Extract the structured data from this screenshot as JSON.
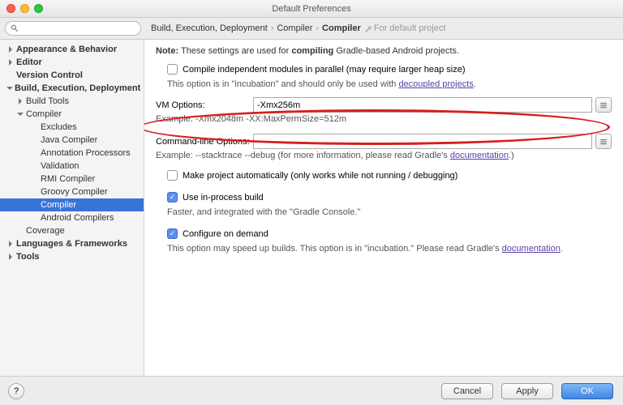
{
  "window": {
    "title": "Default Preferences"
  },
  "search": {
    "placeholder": ""
  },
  "breadcrumb": {
    "parts": [
      "Build, Execution, Deployment",
      "Compiler",
      "Compiler"
    ],
    "hint": "For default project"
  },
  "sidebar": {
    "items": [
      {
        "label": "Appearance & Behavior",
        "depth": 0,
        "arrow": "right",
        "bold": true
      },
      {
        "label": "Editor",
        "depth": 0,
        "arrow": "right",
        "bold": true
      },
      {
        "label": "Version Control",
        "depth": 0,
        "arrow": "none",
        "bold": true
      },
      {
        "label": "Build, Execution, Deployment",
        "depth": 0,
        "arrow": "down",
        "bold": true
      },
      {
        "label": "Build Tools",
        "depth": 1,
        "arrow": "right",
        "bold": false
      },
      {
        "label": "Compiler",
        "depth": 1,
        "arrow": "down",
        "bold": false
      },
      {
        "label": "Excludes",
        "depth": 2,
        "arrow": "none",
        "bold": false
      },
      {
        "label": "Java Compiler",
        "depth": 2,
        "arrow": "none",
        "bold": false
      },
      {
        "label": "Annotation Processors",
        "depth": 2,
        "arrow": "none",
        "bold": false
      },
      {
        "label": "Validation",
        "depth": 2,
        "arrow": "none",
        "bold": false
      },
      {
        "label": "RMI Compiler",
        "depth": 2,
        "arrow": "none",
        "bold": false
      },
      {
        "label": "Groovy Compiler",
        "depth": 2,
        "arrow": "none",
        "bold": false
      },
      {
        "label": "Compiler",
        "depth": 2,
        "arrow": "none",
        "bold": false,
        "selected": true
      },
      {
        "label": "Android Compilers",
        "depth": 2,
        "arrow": "none",
        "bold": false
      },
      {
        "label": "Coverage",
        "depth": 1,
        "arrow": "none",
        "bold": false
      },
      {
        "label": "Languages & Frameworks",
        "depth": 0,
        "arrow": "right",
        "bold": true
      },
      {
        "label": "Tools",
        "depth": 0,
        "arrow": "right",
        "bold": true
      }
    ]
  },
  "content": {
    "note_prefix": "Note:",
    "note_text": "These settings are used for",
    "note_bold": "compiling",
    "note_suffix": "Gradle-based Android projects.",
    "compile_parallel": "Compile independent modules in parallel (may require larger heap size)",
    "incubation_prefix": "This option is in \"incubation\" and should only be used with",
    "incubation_link": "decoupled projects",
    "vm_label": "VM Options:",
    "vm_value": "-Xmx256m",
    "vm_example": "Example: -Xmx2048m -XX:MaxPermSize=512m",
    "cli_label": "Command-line Options:",
    "cli_value": "",
    "cli_example_prefix": "Example: --stacktrace --debug (for more information, please read Gradle's",
    "cli_example_link": "documentation",
    "cli_example_suffix": ".)",
    "auto_make": "Make project automatically (only works while not running / debugging)",
    "inproc": "Use in-process build",
    "inproc_hint": "Faster, and integrated with the \"Gradle Console.\"",
    "config_demand": "Configure on demand",
    "config_demand_hint_prefix": "This option may speed up builds. This option is in \"incubation.\" Please read Gradle's",
    "config_demand_link": "documentation",
    "config_demand_suffix": "."
  },
  "footer": {
    "cancel": "Cancel",
    "apply": "Apply",
    "ok": "OK",
    "help": "?"
  }
}
